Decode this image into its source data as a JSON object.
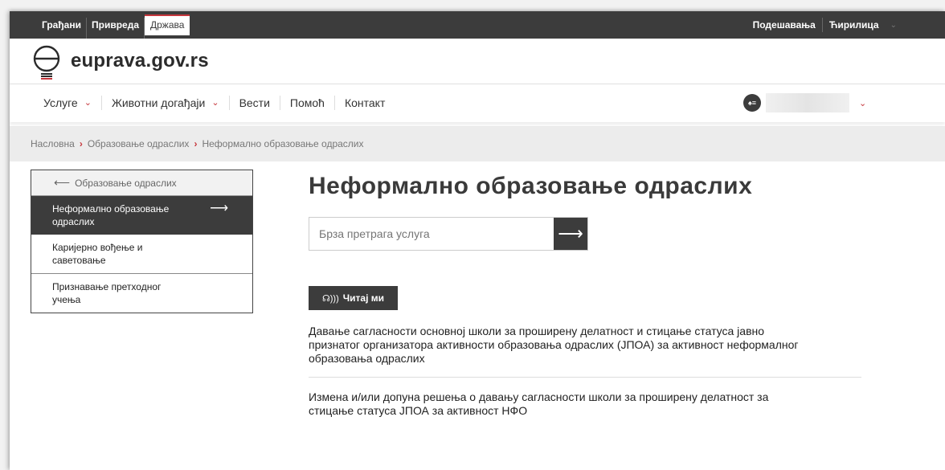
{
  "topbar": {
    "links": [
      "Грађани",
      "Привреда",
      "Држава"
    ],
    "active_link": "Држава",
    "settings": "Подешавања",
    "script": "Ћирилица"
  },
  "logo": {
    "text": "euprava.gov.rs"
  },
  "nav": {
    "items": [
      {
        "label": "Услуге",
        "dropdown": true
      },
      {
        "label": "Животни догађаји",
        "dropdown": true
      },
      {
        "label": "Вести",
        "dropdown": false
      },
      {
        "label": "Помоћ",
        "dropdown": false
      },
      {
        "label": "Контакт",
        "dropdown": false
      }
    ],
    "user_avatar_icon": "user-list-icon"
  },
  "breadcrumb": [
    "Насловна",
    "Образовање одраслих",
    "Неформално образовање одраслих"
  ],
  "sidebar": {
    "back_label": "Образовање одраслих",
    "items": [
      {
        "label": "Неформално образовање одраслих",
        "active": true
      },
      {
        "label": "Каријерно вођење и саветовање",
        "active": false
      },
      {
        "label": "Признавање претходног учења",
        "active": false
      }
    ]
  },
  "main": {
    "title": "Неформално образовање одраслих",
    "search_placeholder": "Брза претрага услуга",
    "read_button": "Читај ми",
    "services": [
      "Давање сагласности основној школи за проширену делатност и стицање статуса јавно признатог организатора активности образовања одраслих (ЈПОА) за активност неформалног образовања одраслих",
      "Измена и/или допуна решења о давању сагласности школи за проширену делатност за стицање статуса ЈПОА за активност НФО"
    ]
  },
  "colors": {
    "accent": "#c6363c",
    "dark": "#3c3c3c"
  }
}
